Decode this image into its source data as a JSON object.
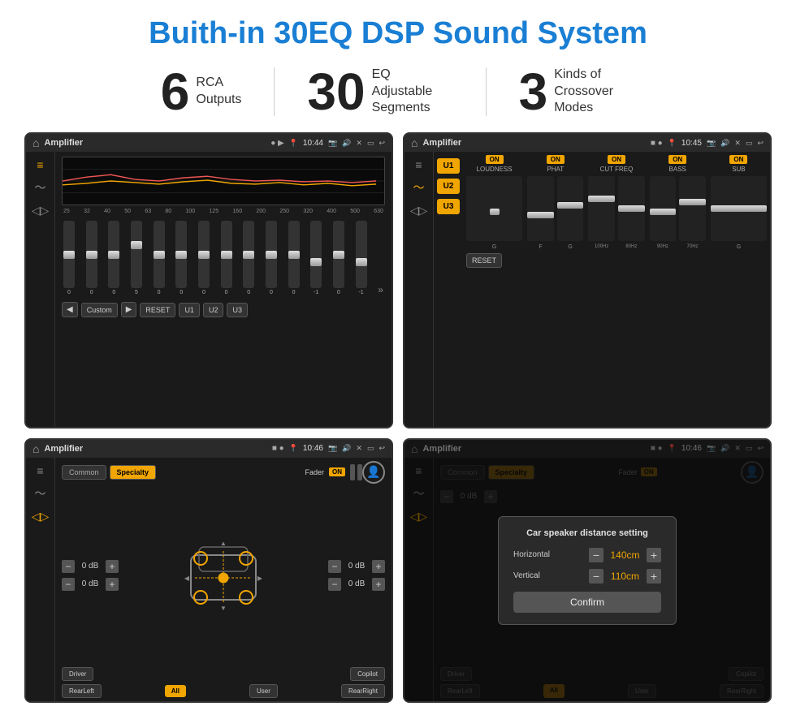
{
  "header": {
    "title": "Buith-in 30EQ DSP Sound System"
  },
  "stats": [
    {
      "number": "6",
      "label_line1": "RCA",
      "label_line2": "Outputs"
    },
    {
      "number": "30",
      "label_line1": "EQ Adjustable",
      "label_line2": "Segments"
    },
    {
      "number": "3",
      "label_line1": "Kinds of",
      "label_line2": "Crossover Modes"
    }
  ],
  "screens": [
    {
      "id": "screen1",
      "status_title": "Amplifier",
      "status_time": "10:44",
      "type": "eq"
    },
    {
      "id": "screen2",
      "status_title": "Amplifier",
      "status_time": "10:45",
      "type": "amp"
    },
    {
      "id": "screen3",
      "status_title": "Amplifier",
      "status_time": "10:46",
      "type": "specialty"
    },
    {
      "id": "screen4",
      "status_title": "Amplifier",
      "status_time": "10:46",
      "type": "dialog"
    }
  ],
  "eq": {
    "frequencies": [
      "25",
      "32",
      "40",
      "50",
      "63",
      "80",
      "100",
      "125",
      "160",
      "200",
      "250",
      "320",
      "400",
      "500",
      "630"
    ],
    "values": [
      "0",
      "0",
      "0",
      "5",
      "0",
      "0",
      "0",
      "0",
      "0",
      "0",
      "0",
      "-1",
      "0",
      "-1",
      ""
    ],
    "presets": [
      "Custom",
      "RESET",
      "U1",
      "U2",
      "U3"
    ]
  },
  "amp": {
    "u_buttons": [
      "U1",
      "U2",
      "U3"
    ],
    "controls": [
      "LOUDNESS",
      "PHAT",
      "CUT FREQ",
      "BASS",
      "SUB"
    ],
    "reset_label": "RESET"
  },
  "specialty": {
    "tabs": [
      "Common",
      "Specialty"
    ],
    "fader_label": "Fader",
    "fader_on": "ON",
    "db_values": [
      "0 dB",
      "0 dB",
      "0 dB",
      "0 dB"
    ],
    "bottom_buttons": [
      "Driver",
      "Copilot",
      "RearLeft",
      "All",
      "User",
      "RearRight"
    ]
  },
  "dialog": {
    "title": "Car speaker distance setting",
    "horizontal_label": "Horizontal",
    "horizontal_value": "140cm",
    "vertical_label": "Vertical",
    "vertical_value": "110cm",
    "confirm_label": "Confirm",
    "db_values": [
      "0 dB",
      "0 dB"
    ]
  }
}
